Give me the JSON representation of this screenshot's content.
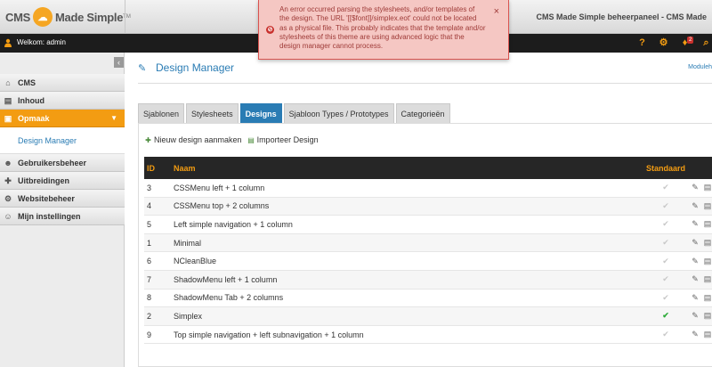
{
  "header": {
    "logo_left": "CMS",
    "logo_right": "Made Simple",
    "logo_tm": "TM",
    "title": "CMS Made Simple beheerpaneel - CMS Made"
  },
  "error": {
    "message": "An error occurred parsing the stylesheets, and/or templates of the design. The URL '[[$font]]/simplex.eot' could not be located as a physical file. This probably indicates that the template and/or stylesheets of this theme are using advanced logic that the design manager cannot process.",
    "close": "×"
  },
  "toolbar": {
    "welcome": "Welkom: admin",
    "notification_count": "2"
  },
  "sidebar": {
    "collapse": "‹",
    "items": [
      {
        "label": "CMS"
      },
      {
        "label": "Inhoud"
      },
      {
        "label": "Opmaak"
      },
      {
        "label": "Design Manager"
      },
      {
        "label": "Gebruikersbeheer"
      },
      {
        "label": "Uitbreidingen"
      },
      {
        "label": "Websitebeheer"
      },
      {
        "label": "Mijn instellingen"
      }
    ]
  },
  "main": {
    "title": "Design Manager",
    "module_help": "Moduleh",
    "tabs": [
      {
        "label": "Sjablonen"
      },
      {
        "label": "Stylesheets"
      },
      {
        "label": "Designs"
      },
      {
        "label": "Sjabloon Types / Prototypes"
      },
      {
        "label": "Categorieën"
      }
    ],
    "actions": {
      "new_design": "Nieuw design aanmaken",
      "import_design": "Importeer Design"
    },
    "table": {
      "headers": {
        "id": "ID",
        "name": "Naam",
        "default": "Standaard"
      },
      "rows": [
        {
          "id": "3",
          "name": "CSSMenu left + 1 column",
          "default": false
        },
        {
          "id": "4",
          "name": "CSSMenu top + 2 columns",
          "default": false
        },
        {
          "id": "5",
          "name": "Left simple navigation + 1 column",
          "default": false
        },
        {
          "id": "1",
          "name": "Minimal",
          "default": false
        },
        {
          "id": "6",
          "name": "NCleanBlue",
          "default": false
        },
        {
          "id": "7",
          "name": "ShadowMenu left + 1 column",
          "default": false
        },
        {
          "id": "8",
          "name": "ShadowMenu Tab + 2 columns",
          "default": false
        },
        {
          "id": "2",
          "name": "Simplex",
          "default": true
        },
        {
          "id": "9",
          "name": "Top simple navigation + left subnavigation + 1 column",
          "default": false
        }
      ]
    }
  },
  "colors": {
    "accent": "#f39c12",
    "link": "#2a7cb4",
    "error_bg": "#f5c7c3",
    "check_on": "#2eab3a"
  }
}
